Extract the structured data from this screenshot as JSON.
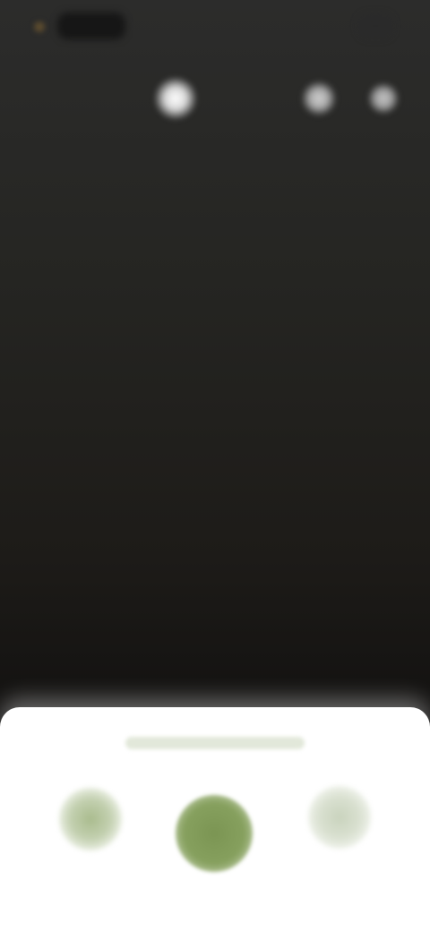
{
  "status_bar": {
    "indicator_color": "#5a4a2e"
  },
  "top_controls": {
    "icons": [
      "flash-icon",
      "timer-icon",
      "settings-icon"
    ]
  },
  "viewfinder": {
    "colors": [
      "#2c2c2b",
      "#1d1b18",
      "#0d0c0b"
    ]
  },
  "bottom_panel": {
    "mode_label": "",
    "accent_color": "#7b9553",
    "controls": [
      "gallery-thumbnail",
      "shutter-button",
      "switch-camera-button"
    ]
  }
}
